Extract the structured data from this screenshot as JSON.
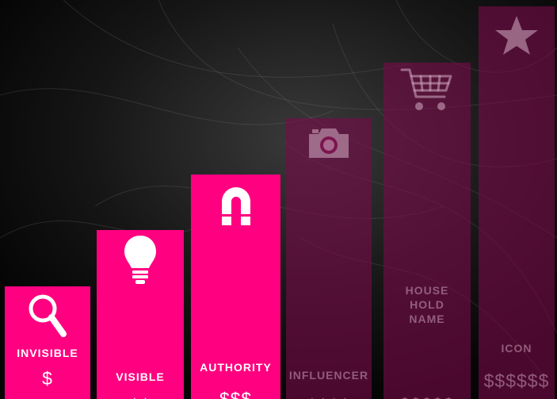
{
  "chart_data": {
    "type": "bar",
    "categories": [
      "INVISIBLE",
      "VISIBLE",
      "AUTHORITY",
      "INFLUENCER",
      "HOUSE\nHOLD\nNAME",
      "ICON"
    ],
    "prices": [
      "$",
      "$$",
      "$$$",
      "$$$$",
      "$$$$$",
      "$$$$$$"
    ],
    "values": [
      1,
      2,
      3,
      4,
      5,
      6
    ],
    "icons": [
      "magnifier-icon",
      "lightbulb-icon",
      "magnet-icon",
      "camera-icon",
      "shopping-cart-icon",
      "star-icon"
    ],
    "highlighted": [
      true,
      true,
      true,
      false,
      false,
      false
    ],
    "colors": {
      "active": "#ff0080",
      "inactive": "#780c48",
      "background": "#050505"
    }
  }
}
